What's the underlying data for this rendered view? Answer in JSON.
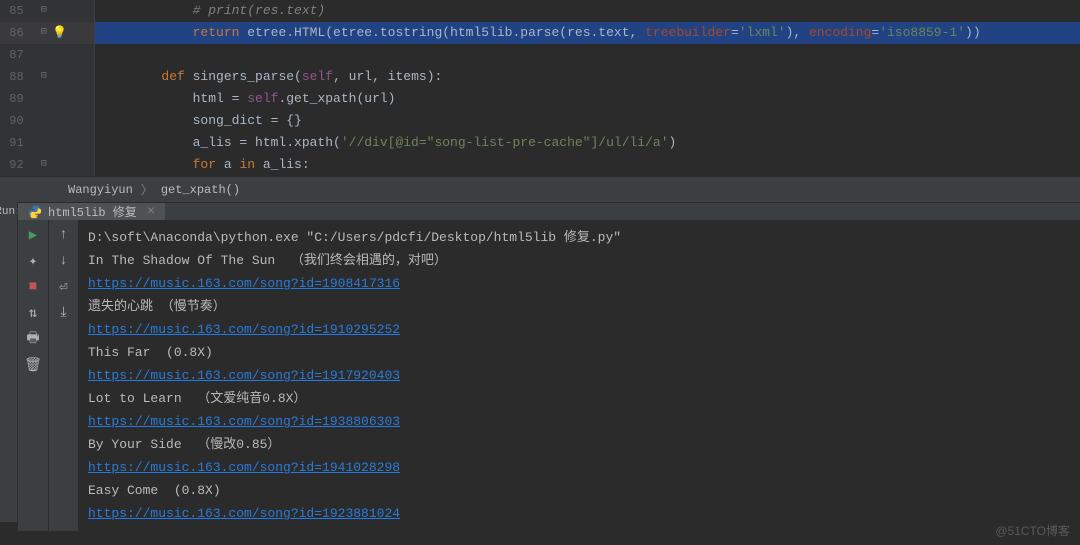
{
  "gutter": {
    "lines": [
      "85",
      "86",
      "87",
      "88",
      "89",
      "90",
      "91",
      "92"
    ]
  },
  "code": {
    "l85": "            # print(res.text)",
    "l86a": "return",
    "l86b": " etree.HTML(etree.tostring(html5lib.parse(res.text, ",
    "l86c": "treebuilder",
    "l86d": "=",
    "l86e": "'lxml'",
    "l86f": "), ",
    "l86g": "encoding",
    "l86h": "=",
    "l86i": "'iso8859-1'",
    "l86j": "))",
    "l88a": "def",
    "l88b": " singers_parse(",
    "l88c": "self",
    "l88d": ", url, items):",
    "l89a": "            html = ",
    "l89b": "self",
    "l89c": ".get_xpath(url)",
    "l90": "            song_dict = {}",
    "l91a": "            a_lis = html.xpath(",
    "l91b": "'//div[@id=\"song-list-pre-cache\"]/ul/li/a'",
    "l91c": ")",
    "l92a": "for",
    "l92b": " a ",
    "l92c": "in",
    "l92d": " a_lis:"
  },
  "breadcrumb": {
    "item1": "Wangyiyun",
    "item2": "get_xpath()"
  },
  "run": {
    "label": "Run:",
    "tab": "html5lib 修复"
  },
  "console": {
    "line1": "D:\\soft\\Anaconda\\python.exe \"C:/Users/pdcfi/Desktop/html5lib 修复.py\"",
    "line2": "In The Shadow Of The Sun  （我们终会相遇的，对吧）",
    "link1": "https://music.163.com/song?id=1908417316",
    "line3": "遗失的心跳 （慢节奏）",
    "link2": "https://music.163.com/song?id=1910295252",
    "line4": "This Far  (0.8X)",
    "link3": "https://music.163.com/song?id=1917920403",
    "line5": "Lot to Learn  （文爱纯音0.8X）",
    "link4": "https://music.163.com/song?id=1938806303",
    "line6": "By Your Side  （慢改0.85）",
    "link5": "https://music.163.com/song?id=1941028298",
    "line7": "Easy Come  (0.8X)",
    "link6": "https://music.163.com/song?id=1923881024"
  },
  "watermark": "@51CTO博客"
}
